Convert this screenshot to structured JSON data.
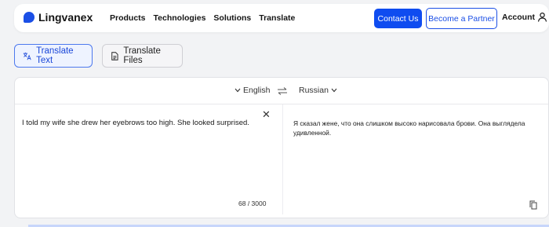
{
  "header": {
    "logo": "Lingvanex",
    "nav": [
      "Products",
      "Technologies",
      "Solutions",
      "Translate"
    ],
    "contact_label": "Contact Us",
    "partner_label": "Become a Partner",
    "account_label": "Account"
  },
  "tabs": {
    "translate_text": "Translate Text",
    "translate_files": "Translate Files"
  },
  "languages": {
    "source": "English",
    "target": "Russian"
  },
  "source": {
    "text": "I told my wife she drew her eyebrows too high. She looked surprised.",
    "counter": "68 / 3000"
  },
  "target": {
    "text": "Я сказал жене, что она слишком высоко нарисовала брови. Она выглядела удивленной."
  },
  "colors": {
    "accent": "#0f4cf0",
    "background": "#f2f3f5"
  }
}
